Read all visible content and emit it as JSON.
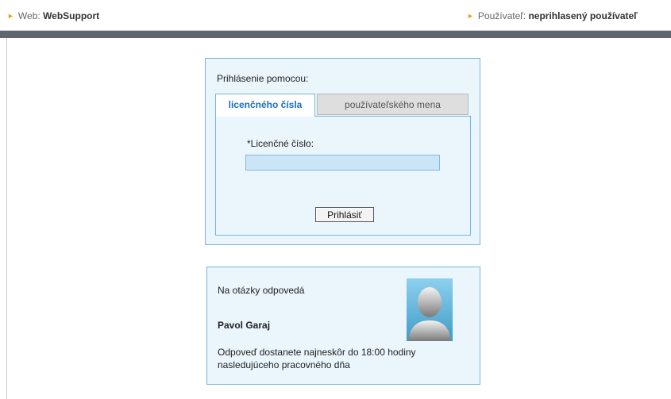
{
  "header": {
    "web_label": "Web:",
    "web_value": "WebSupport",
    "user_label": "Používateľ:",
    "user_value": "neprihlasený používateľ"
  },
  "login": {
    "title": "Prihlásenie pomocou:",
    "tabs": [
      {
        "label": "licenčného čísla",
        "active": true
      },
      {
        "label": "používateľského mena",
        "active": false
      }
    ],
    "field_label": "*Licenčné číslo:",
    "field_value": "",
    "submit_label": "Prihlásiť"
  },
  "support": {
    "intro": "Na otázky odpovedá",
    "name": "Pavol Garaj",
    "reply_note": "Odpoveď dostanete najneskôr do 18:00 hodiny nasledujúceho pracovného dňa",
    "avatar_icon": "user-avatar-silhouette"
  },
  "colors": {
    "accent_blue": "#1a6fc0",
    "box_border": "#77b6dc",
    "box_bg": "#eaf5fc",
    "dark_bar": "#5f6670",
    "arrow": "#e8a020"
  }
}
